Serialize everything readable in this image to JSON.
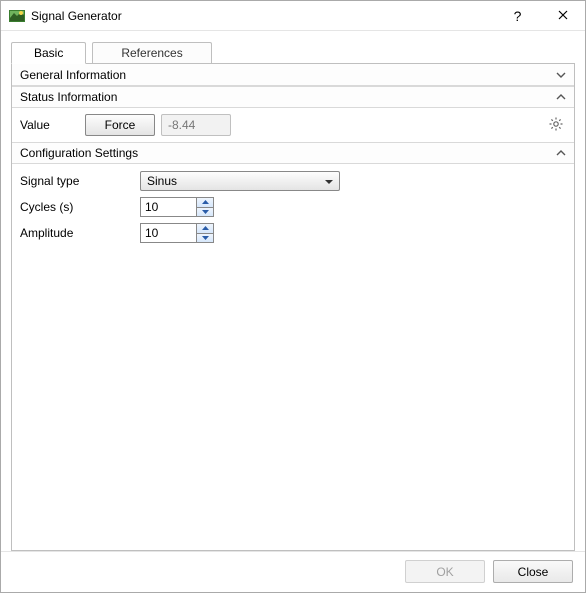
{
  "window": {
    "title": "Signal Generator",
    "help_symbol": "?",
    "close_label": "Close"
  },
  "tabs": {
    "basic": "Basic",
    "references": "References"
  },
  "sections": {
    "general": {
      "title": "General Information"
    },
    "status": {
      "title": "Status Information",
      "value_label": "Value",
      "force_label": "Force",
      "value": "-8.44"
    },
    "config": {
      "title": "Configuration Settings",
      "signal_type_label": "Signal type",
      "signal_type_value": "Sinus",
      "cycles_label": "Cycles (s)",
      "cycles_value": "10",
      "amplitude_label": "Amplitude",
      "amplitude_value": "10"
    }
  },
  "footer": {
    "ok": "OK",
    "close": "Close"
  }
}
